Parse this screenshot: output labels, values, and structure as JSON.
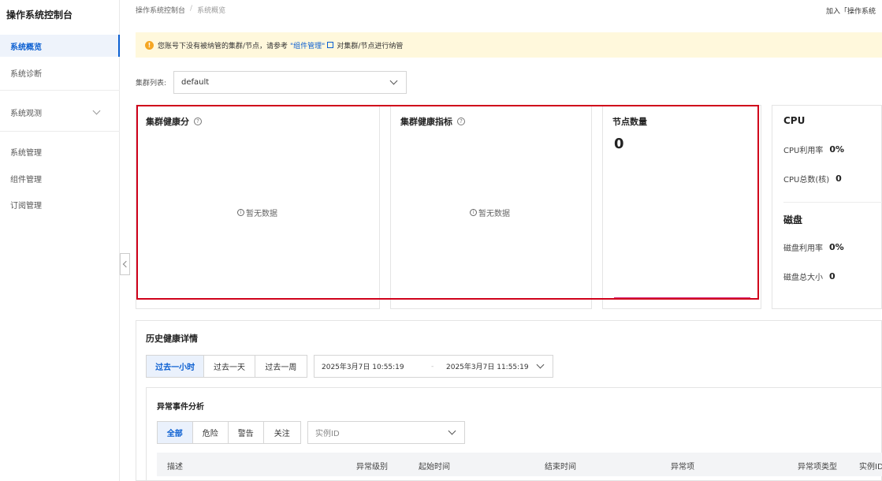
{
  "sidebar": {
    "title": "操作系统控制台",
    "items": [
      {
        "label": "系统概览"
      },
      {
        "label": "系统诊断"
      },
      {
        "label": "系统观测"
      },
      {
        "label": "系统管理"
      },
      {
        "label": "组件管理"
      },
      {
        "label": "订阅管理"
      }
    ]
  },
  "breadcrumb": {
    "root": "操作系统控制台",
    "sep": "/",
    "current": "系统概览"
  },
  "top_right": "加入「操作系统",
  "notice": {
    "prefix": "您账号下没有被纳管的集群/节点，请参考",
    "link": "\"组件管理\"",
    "suffix": "对集群/节点进行纳管",
    "icon": "!"
  },
  "cluster": {
    "label": "集群列表:",
    "value": "default"
  },
  "cards": {
    "health_score": {
      "title": "集群健康分",
      "empty": "暂无数据"
    },
    "health_metrics": {
      "title": "集群健康指标",
      "empty": "暂无数据"
    },
    "node_count": {
      "title": "节点数量",
      "value": "0"
    },
    "resources": {
      "cpu_title": "CPU",
      "cpu_usage_label": "CPU利用率",
      "cpu_usage_value": "0%",
      "cpu_cores_label": "CPU总数(核)",
      "cpu_cores_value": "0",
      "disk_title": "磁盘",
      "disk_usage_label": "磁盘利用率",
      "disk_usage_value": "0%",
      "disk_size_label": "磁盘总大小",
      "disk_size_value": "0"
    }
  },
  "history": {
    "title": "历史健康详情",
    "ranges": [
      "过去一小时",
      "过去一天",
      "过去一周"
    ],
    "start": "2025年3月7日 10:55:19",
    "dash": "-",
    "end": "2025年3月7日 11:55:19"
  },
  "anomaly": {
    "title": "异常事件分析",
    "filters": [
      "全部",
      "危险",
      "警告",
      "关注"
    ],
    "instance_placeholder": "实例ID",
    "columns": [
      "描述",
      "异常级别",
      "起始时间",
      "结束时间",
      "异常项",
      "异常项类型",
      "实例ID"
    ]
  },
  "colors": {
    "primary": "#0b5fd1",
    "highlight": "#d0021b",
    "notice_bg": "#fff8dc",
    "warn": "#f5a623"
  }
}
